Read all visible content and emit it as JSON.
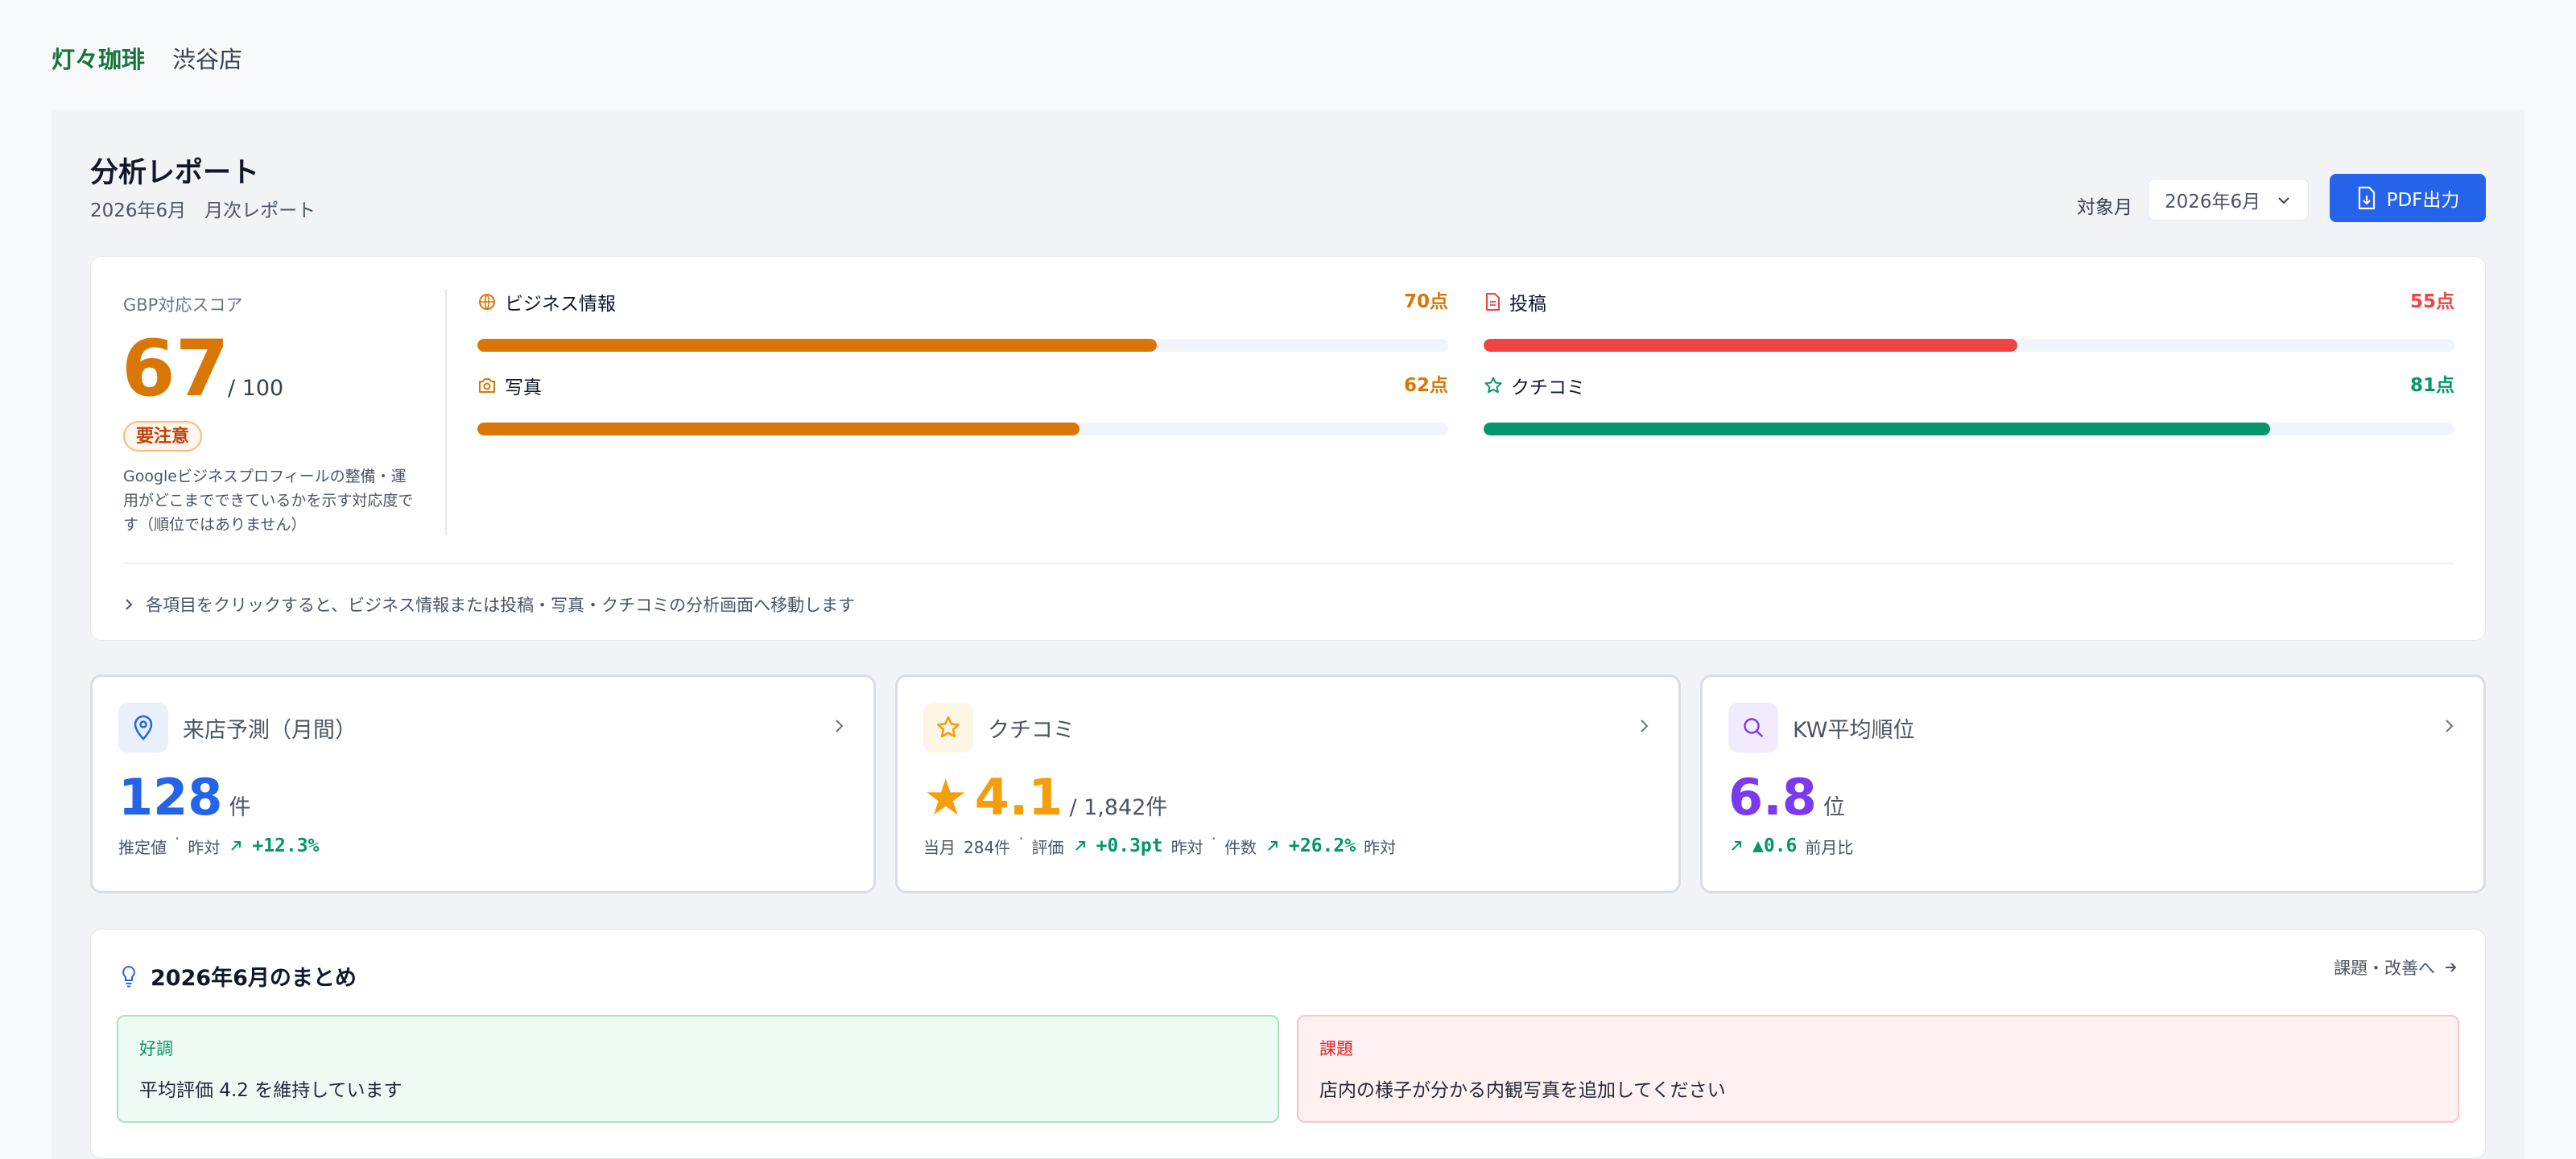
{
  "header": {
    "brand": "灯々珈琲",
    "store": "渋谷店"
  },
  "page": {
    "title": "分析レポート",
    "subtitle": "2026年6月　月次レポート",
    "month_label": "対象月",
    "month_value": "2026年6月",
    "pdf_button": "PDF出力"
  },
  "gbp": {
    "label": "GBP対応スコア",
    "score": "67",
    "max": "/ 100",
    "badge": "要注意",
    "description": "Googleビジネスプロフィールの整備・運用がどこまでできているかを示す対応度です（順位ではありません）",
    "categories": [
      {
        "name": "ビジネス情報",
        "points": "70点",
        "score": 70,
        "color": "#d97706",
        "icon": "globe-icon"
      },
      {
        "name": "投稿",
        "points": "55点",
        "score": 55,
        "color": "#ef4444",
        "icon": "document-icon"
      },
      {
        "name": "写真",
        "points": "62点",
        "score": 62,
        "color": "#d97706",
        "icon": "camera-icon"
      },
      {
        "name": "クチコミ",
        "points": "81点",
        "score": 81,
        "color": "#059669",
        "icon": "star-icon"
      }
    ],
    "hint": "各項目をクリックすると、ビジネス情報または投稿・写真・クチコミの分析画面へ移動します"
  },
  "kpis": {
    "visits": {
      "title": "来店予測（月間）",
      "value": "128",
      "unit": "件",
      "meta_label": "推定値",
      "compare_label": "昨対",
      "change": "+12.3%",
      "color": "#2563eb"
    },
    "reviews": {
      "title": "クチコミ",
      "star": "★",
      "value": "4.1",
      "unit": "/ 1,842件",
      "month_label": "当月",
      "month_count": "284件",
      "rating_label": "評価",
      "rating_change": "+0.3pt",
      "rating_compare": "昨対",
      "count_label": "件数",
      "count_change": "+26.2%",
      "count_compare": "昨対",
      "color": "#f59e0b"
    },
    "keyword": {
      "title": "KW平均順位",
      "value": "6.8",
      "unit": "位",
      "change": "▲0.6",
      "compare_label": "前月比",
      "color": "#7c3aed"
    }
  },
  "summary": {
    "title": "2026年6月のまとめ",
    "link": "課題・改善へ",
    "good_label": "好調",
    "good_text": "平均評価 4.2 を維持しています",
    "bad_label": "課題",
    "bad_text": "店内の様子が分かる内観写真を追加してください"
  }
}
